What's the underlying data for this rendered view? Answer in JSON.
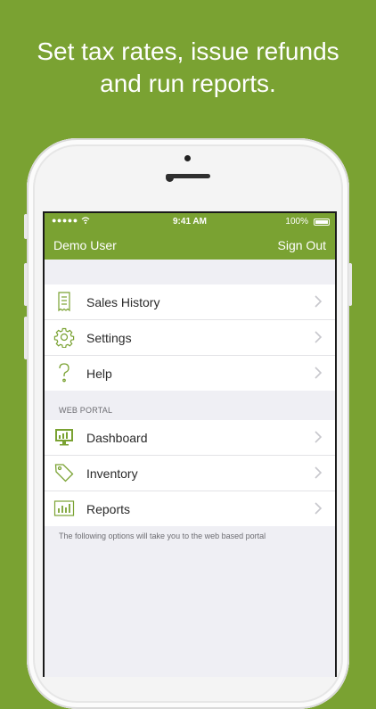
{
  "headline": {
    "line1": "Set tax rates, issue refunds",
    "line2": "and run reports."
  },
  "status_bar": {
    "signal": "●●●●● ",
    "time": "9:41 AM",
    "battery": "100%"
  },
  "nav": {
    "user": "Demo User",
    "sign_out": "Sign Out"
  },
  "menu": [
    {
      "label": "Sales History",
      "icon": "receipt-icon"
    },
    {
      "label": "Settings",
      "icon": "gear-icon"
    },
    {
      "label": "Help",
      "icon": "question-icon"
    }
  ],
  "web_portal": {
    "header": "WEB PORTAL",
    "items": [
      {
        "label": "Dashboard",
        "icon": "monitor-icon"
      },
      {
        "label": "Inventory",
        "icon": "tag-icon"
      },
      {
        "label": "Reports",
        "icon": "bar-chart-icon"
      }
    ],
    "note": "The following options will take you to the web based portal"
  },
  "colors": {
    "brand_green": "#7aa232",
    "background": "#efeff4"
  }
}
